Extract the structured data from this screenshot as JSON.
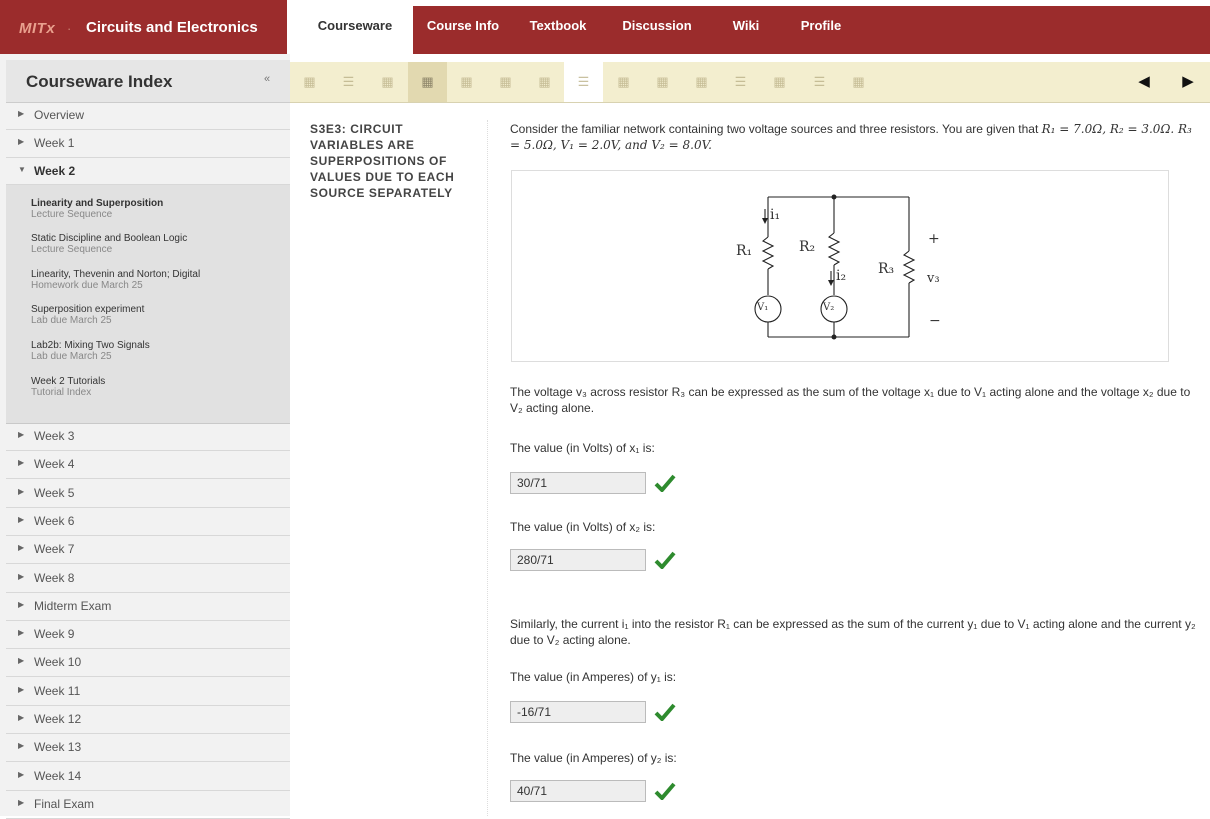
{
  "brand": {
    "logo": "MITx",
    "separator": "·",
    "course": "Circuits and Electronics"
  },
  "nav": {
    "tabs": [
      "Courseware",
      "Course Info",
      "Textbook",
      "Discussion",
      "Wiki",
      "Profile"
    ],
    "active": "Courseware"
  },
  "sidebar": {
    "title": "Courseware Index",
    "collapse_icon": "«",
    "weeks_before": [
      "Overview",
      "Week 1"
    ],
    "open_week": "Week 2",
    "open_items": [
      {
        "title": "Linearity and Superposition",
        "sub": "Lecture Sequence"
      },
      {
        "title": "Static Discipline and Boolean Logic",
        "sub": "Lecture Sequence"
      },
      {
        "title": "Linearity, Thevenin and Norton; Digital",
        "sub": "Homework due March 25"
      },
      {
        "title": "Superposition experiment",
        "sub": "Lab due March 25"
      },
      {
        "title": "Lab2b: Mixing Two Signals",
        "sub": "Lab due March 25"
      },
      {
        "title": "Week 2 Tutorials",
        "sub": "Tutorial Index"
      }
    ],
    "weeks_after": [
      "Week 3",
      "Week 4",
      "Week 5",
      "Week 6",
      "Week 7",
      "Week 8",
      "Midterm Exam",
      "Week 9",
      "Week 10",
      "Week 11",
      "Week 12",
      "Week 13",
      "Week 14",
      "Final Exam"
    ]
  },
  "sequence": {
    "icons": [
      "video-icon",
      "list-icon",
      "video-icon",
      "video-icon",
      "video-icon",
      "video-icon",
      "video-icon",
      "list-icon",
      "video-icon",
      "video-icon",
      "video-icon",
      "list-icon",
      "video-icon",
      "list-icon",
      "video-icon"
    ],
    "prev": "◀",
    "next": "▶"
  },
  "section_title": "S3E3: CIRCUIT VARIABLES ARE SUPERPOSITIONS OF VALUES DUE TO EACH SOURCE SEPARATELY",
  "problem": {
    "intro_1": "Consider the familiar network containing two voltage sources and three resistors. You are given that ",
    "intro_values": "R₁ = 7.0Ω, R₂ = 3.0Ω. R₃ = 5.0Ω, V₁ = 2.0V, and V₂ = 8.0V.",
    "diagram_labels": {
      "i1": "i₁",
      "i2": "i₂",
      "r1": "R₁",
      "r2": "R₂",
      "r3": "R₃",
      "v1": "V₁",
      "v2": "V₂",
      "v3": "v₃",
      "plus": "+",
      "minus": "−"
    },
    "voltage_text": "The voltage v₃ across resistor R₃ can be expressed as the sum of the voltage x₁ due to V₁ acting alone and the voltage x₂ due to V₂ acting alone.",
    "current_text": "Similarly, the current i₁ into the resistor R₁ can be expressed as the sum of the current y₁ due to V₁ acting alone and the current y₂ due to V₂ acting alone.",
    "questions": [
      {
        "label": "The value (in Volts) of x₁ is:",
        "answer": "30/71",
        "status": "correct"
      },
      {
        "label": "The value (in Volts) of x₂ is:",
        "answer": "280/71",
        "status": "correct"
      },
      {
        "label": "The value (in Amperes) of y₁ is:",
        "answer": "-16/71",
        "status": "correct"
      },
      {
        "label": "The value (in Amperes) of y₂ is:",
        "answer": "40/71",
        "status": "correct"
      }
    ]
  },
  "colors": {
    "brand": "#9b2c2c",
    "sequence_bg": "#f3eecf",
    "check": "#2e8b2e"
  }
}
